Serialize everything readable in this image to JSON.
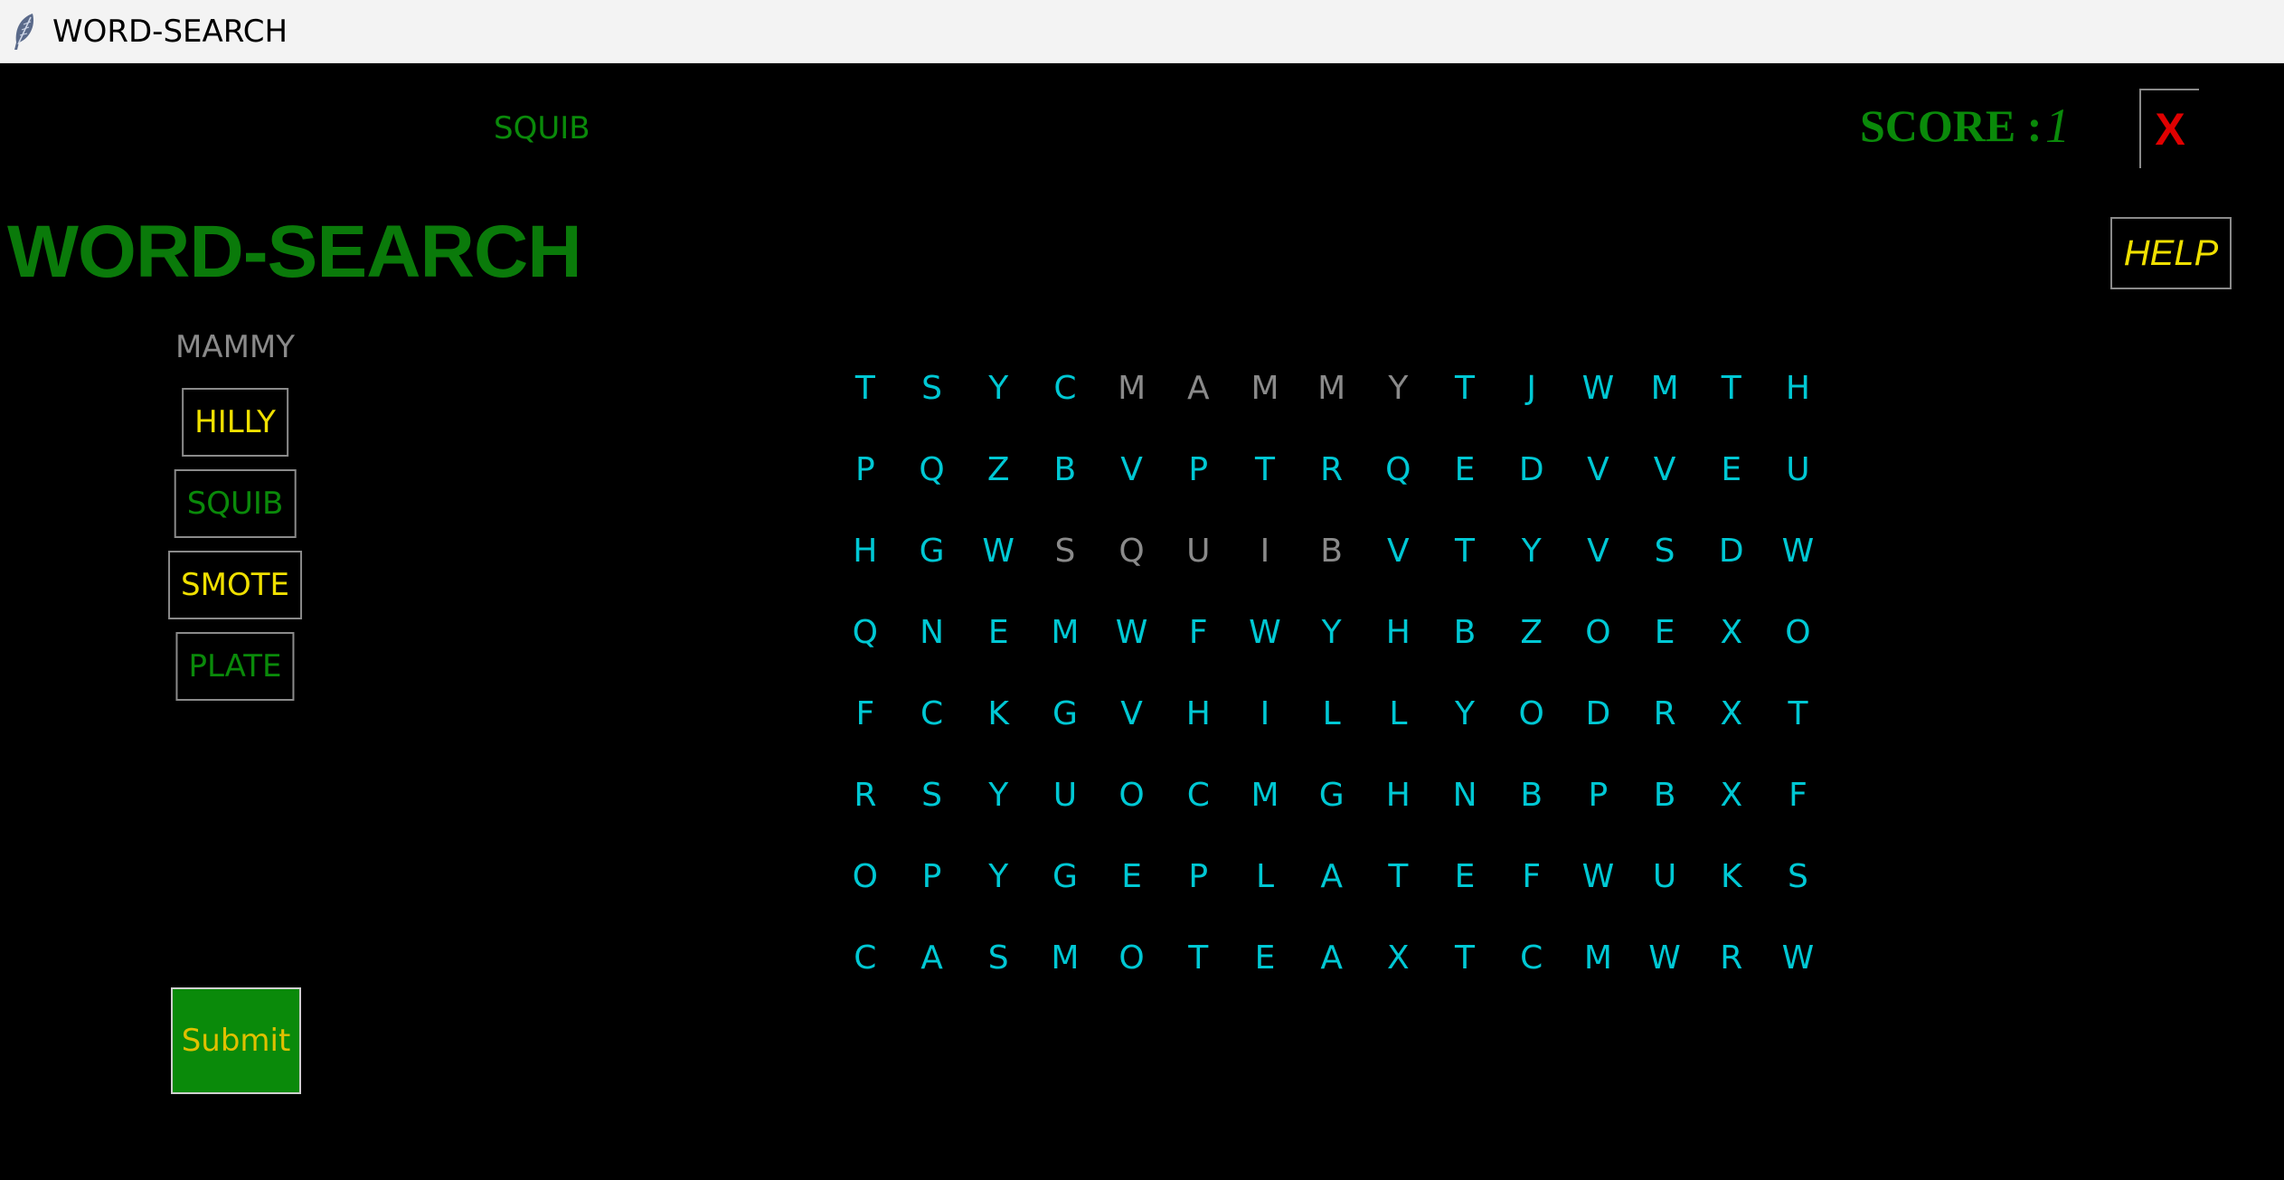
{
  "window": {
    "title": "WORD-SEARCH",
    "icon": "feather-icon"
  },
  "current_word": "SQUIB",
  "score": {
    "label": "SCORE :",
    "value": "1"
  },
  "close_button": {
    "label": "X"
  },
  "help_button": {
    "label": "HELP"
  },
  "app_title": "WORD-SEARCH",
  "words": [
    {
      "text": "MAMMY",
      "color": "#8a8a8a",
      "boxed": false,
      "status": "found"
    },
    {
      "text": "HILLY",
      "color": "#f0e000",
      "boxed": true,
      "status": "unfound"
    },
    {
      "text": "SQUIB",
      "color": "#0a8a0a",
      "boxed": true,
      "status": "selected"
    },
    {
      "text": "SMOTE",
      "color": "#f0e000",
      "boxed": true,
      "status": "unfound"
    },
    {
      "text": "PLATE",
      "color": "#0a8a0a",
      "boxed": true,
      "status": "selected"
    }
  ],
  "submit_button": {
    "label": "Submit"
  },
  "colors": {
    "grid_letter": "#00c8d4",
    "found_letter": "#8a8a8a",
    "background": "#000000",
    "accent_green": "#0a8a0a",
    "accent_yellow": "#f0e000",
    "close_red": "#e00000"
  },
  "grid": [
    [
      "T",
      "S",
      "Y",
      "C",
      "M",
      "A",
      "M",
      "M",
      "Y",
      "T",
      "J",
      "W",
      "M",
      "T",
      "H"
    ],
    [
      "P",
      "Q",
      "Z",
      "B",
      "V",
      "P",
      "T",
      "R",
      "Q",
      "E",
      "D",
      "V",
      "V",
      "E",
      "U"
    ],
    [
      "H",
      "G",
      "W",
      "S",
      "Q",
      "U",
      "I",
      "B",
      "V",
      "T",
      "Y",
      "V",
      "S",
      "D",
      "W"
    ],
    [
      "Q",
      "N",
      "E",
      "M",
      "W",
      "F",
      "W",
      "Y",
      "H",
      "B",
      "Z",
      "O",
      "E",
      "X",
      "O"
    ],
    [
      "F",
      "C",
      "K",
      "G",
      "V",
      "H",
      "I",
      "L",
      "L",
      "Y",
      "O",
      "D",
      "R",
      "X",
      "T"
    ],
    [
      "R",
      "S",
      "Y",
      "U",
      "O",
      "C",
      "M",
      "G",
      "H",
      "N",
      "B",
      "P",
      "B",
      "X",
      "F"
    ],
    [
      "O",
      "P",
      "Y",
      "G",
      "E",
      "P",
      "L",
      "A",
      "T",
      "E",
      "F",
      "W",
      "U",
      "K",
      "S"
    ],
    [
      "C",
      "A",
      "S",
      "M",
      "O",
      "T",
      "E",
      "A",
      "X",
      "T",
      "C",
      "M",
      "W",
      "R",
      "W"
    ]
  ],
  "found_cells": [
    [
      0,
      4
    ],
    [
      0,
      5
    ],
    [
      0,
      6
    ],
    [
      0,
      7
    ],
    [
      0,
      8
    ],
    [
      2,
      3
    ],
    [
      2,
      4
    ],
    [
      2,
      5
    ],
    [
      2,
      6
    ],
    [
      2,
      7
    ]
  ]
}
